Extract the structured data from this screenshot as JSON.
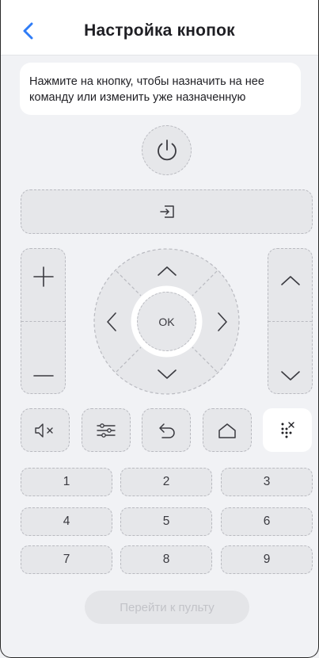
{
  "header": {
    "back_icon": "chevron-left-icon",
    "title": "Настройка кнопок",
    "accent": "#2f7cf6"
  },
  "hint": {
    "text": "Нажмите на кнопку, чтобы назначить на нее команду или изменить уже назначенную"
  },
  "remote": {
    "power_icon": "power-icon",
    "input_icon": "input-source-icon",
    "volume": {
      "up_icon": "plus-icon",
      "down_icon": "minus-icon"
    },
    "channel": {
      "up_icon": "chevron-up-icon",
      "down_icon": "chevron-down-icon"
    },
    "dpad": {
      "ok_label": "OK"
    },
    "function_buttons": [
      {
        "name": "mute",
        "icon": "mute-icon"
      },
      {
        "name": "settings",
        "icon": "settings-sliders-icon"
      },
      {
        "name": "back",
        "icon": "return-icon"
      },
      {
        "name": "home",
        "icon": "home-icon"
      },
      {
        "name": "numpad",
        "icon": "numpad-icon",
        "active": true
      }
    ],
    "numbers": [
      "1",
      "2",
      "3",
      "4",
      "5",
      "6",
      "7",
      "8",
      "9"
    ]
  },
  "footer": {
    "go_to_remote_label": "Перейти к пульту"
  }
}
